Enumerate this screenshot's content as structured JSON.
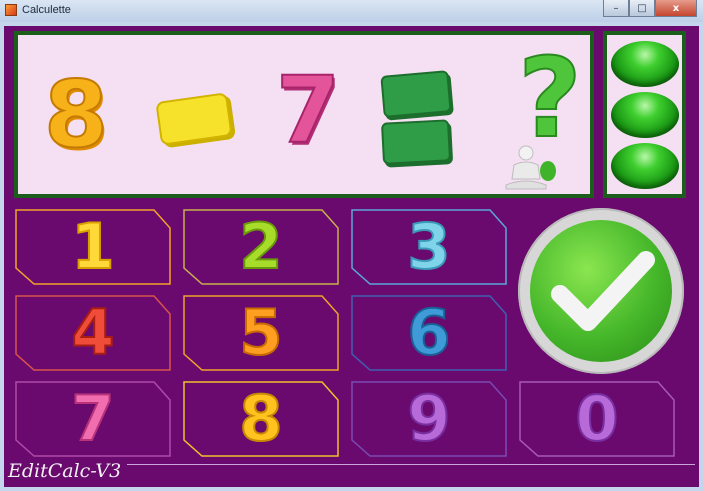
{
  "window": {
    "title": "Calculette",
    "minimize": "–",
    "maximize": "□",
    "close": "x"
  },
  "display": {
    "operand1": "8",
    "operand2": "7",
    "operator": "minus",
    "equals": "equals",
    "result": "?"
  },
  "lights": {
    "count": 3,
    "color": "#2fbf1f"
  },
  "keypad": {
    "keys": [
      {
        "label": "1",
        "outline": "#f2a12a"
      },
      {
        "label": "2",
        "outline": "#c8b04a"
      },
      {
        "label": "3",
        "outline": "#5aa7d8"
      },
      {
        "label": "4",
        "outline": "#d8544a"
      },
      {
        "label": "5",
        "outline": "#f0a22a"
      },
      {
        "label": "6",
        "outline": "#3f5fb0"
      },
      {
        "label": "7",
        "outline": "#b04aa8"
      },
      {
        "label": "8",
        "outline": "#f0c22a"
      },
      {
        "label": "9",
        "outline": "#7a4ab0"
      },
      {
        "label": "0",
        "outline": "#a85ab8"
      }
    ],
    "ok": "check-mark"
  },
  "footer": {
    "version": "EditCalc-V3"
  },
  "colors": {
    "background": "#6a0a6f",
    "display_bg": "#f5dff2",
    "display_border": "#1b5e1b"
  }
}
